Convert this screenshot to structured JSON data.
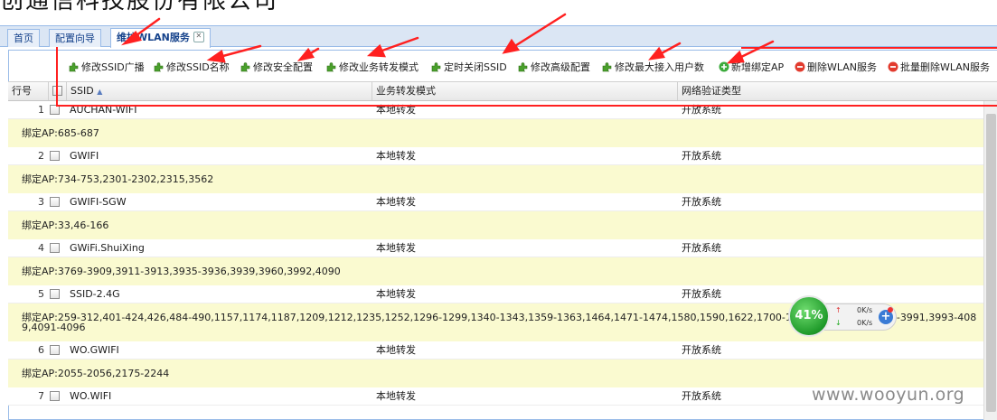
{
  "page_title": "创通信科技股份有限公司",
  "tabs": [
    {
      "label": "首页"
    },
    {
      "label": "配置向导"
    },
    {
      "label": "维护WLAN服务"
    }
  ],
  "toolbar": [
    {
      "label": "修改SSID广播",
      "icon": "edit-puzzle-icon"
    },
    {
      "label": "修改SSID名称",
      "icon": "edit-puzzle-icon"
    },
    {
      "label": "修改安全配置",
      "icon": "edit-puzzle-icon"
    },
    {
      "label": "修改业务转发模式",
      "icon": "edit-puzzle-icon"
    },
    {
      "label": "定时关闭SSID",
      "icon": "edit-puzzle-icon"
    },
    {
      "label": "修改高级配置",
      "icon": "edit-puzzle-icon"
    },
    {
      "label": "修改最大接入用户数",
      "icon": "edit-puzzle-icon"
    },
    {
      "label": "新增绑定AP",
      "icon": "add-green-icon"
    },
    {
      "label": "删除WLAN服务",
      "icon": "delete-red-icon"
    },
    {
      "label": "批量删除WLAN服务",
      "icon": "delete-red-icon"
    }
  ],
  "grid": {
    "columns": {
      "rownum": "行号",
      "ssid": "SSID",
      "mode": "业务转发模式",
      "auth": "网络验证类型"
    },
    "sort_indicator": "▲",
    "rows": [
      {
        "num": "1",
        "ssid": "AUCHAN-WIFI",
        "mode": "本地转发",
        "auth": "开放系统",
        "bind": "绑定AP:685-687"
      },
      {
        "num": "2",
        "ssid": "GWIFI",
        "mode": "本地转发",
        "auth": "开放系统",
        "bind": "绑定AP:734-753,2301-2302,2315,3562"
      },
      {
        "num": "3",
        "ssid": "GWIFI-SGW",
        "mode": "本地转发",
        "auth": "开放系统",
        "bind": "绑定AP:33,46-166"
      },
      {
        "num": "4",
        "ssid": "GWiFi.ShuiXing",
        "mode": "本地转发",
        "auth": "开放系统",
        "bind": "绑定AP:3769-3909,3911-3913,3935-3936,3939,3960,3992,4090"
      },
      {
        "num": "5",
        "ssid": "SSID-2.4G",
        "mode": "本地转发",
        "auth": "开放系统",
        "bind": "绑定AP:259-312,401-424,426,484-490,1157,1174,1187,1209,1212,1235,1252,1296-1299,1340-1343,1359-1363,1464,1471-1474,1580,1590,1622,1700-1753,3940-3959,3961-3991,3993-4089,4091-4096"
      },
      {
        "num": "6",
        "ssid": "WO.GWIFI",
        "mode": "本地转发",
        "auth": "开放系统",
        "bind": "绑定AP:2055-2056,2175-2244"
      },
      {
        "num": "7",
        "ssid": "WO.WIFI",
        "mode": "本地转发",
        "auth": "开放系统",
        "bind": ""
      }
    ]
  },
  "speed_widget": {
    "percent": "41%",
    "up": "0K/s",
    "down": "0K/s"
  },
  "watermark": "www.wooyun.org",
  "colors": {
    "annotation_red": "#ff2020",
    "bind_row_bg": "#fafad0",
    "tab_text": "#15428b"
  }
}
